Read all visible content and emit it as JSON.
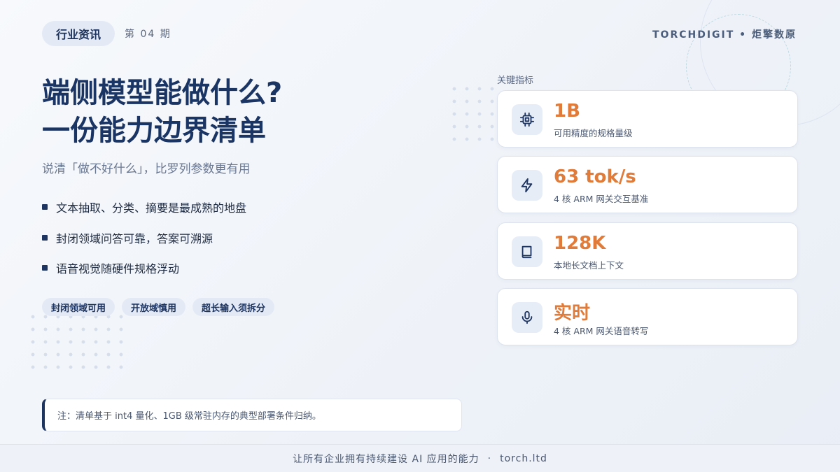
{
  "header": {
    "tag": "行业资讯",
    "issue": "第 04 期",
    "brand": "TORCHDIGIT • 炬擎数原"
  },
  "hero": {
    "title_line1": "端侧模型能做什么?",
    "title_line2": "一份能力边界清单",
    "subtitle": "说清「做不好什么」，比罗列参数更有用"
  },
  "bullets": [
    "文本抽取、分类、摘要是最成熟的地盘",
    "封闭领域问答可靠，答案可溯源",
    "语音视觉随硬件规格浮动"
  ],
  "chips": [
    "封闭领域可用",
    "开放域慎用",
    "超长输入须拆分"
  ],
  "note": "注：清单基于 int4 量化、1GB 级常驻内存的典型部署条件归纳。",
  "metrics": {
    "heading": "关键指标",
    "items": [
      {
        "icon": "chip-icon",
        "value": "1B",
        "label": "可用精度的规格量级"
      },
      {
        "icon": "lightning-icon",
        "value": "63 tok/s",
        "label": "4 核 ARM 网关交互基准"
      },
      {
        "icon": "book-icon",
        "value": "128K",
        "label": "本地长文档上下文"
      },
      {
        "icon": "microphone-icon",
        "value": "实时",
        "label": "4 核 ARM 网关语音转写"
      }
    ]
  },
  "footer": {
    "slogan": "让所有企业拥有持续建设 AI 应用的能力",
    "separator": "·",
    "url": "torch.ltd"
  },
  "colors": {
    "primary": "#1d3461",
    "accent": "#e07b39",
    "chip_bg": "#e3eaf5"
  }
}
